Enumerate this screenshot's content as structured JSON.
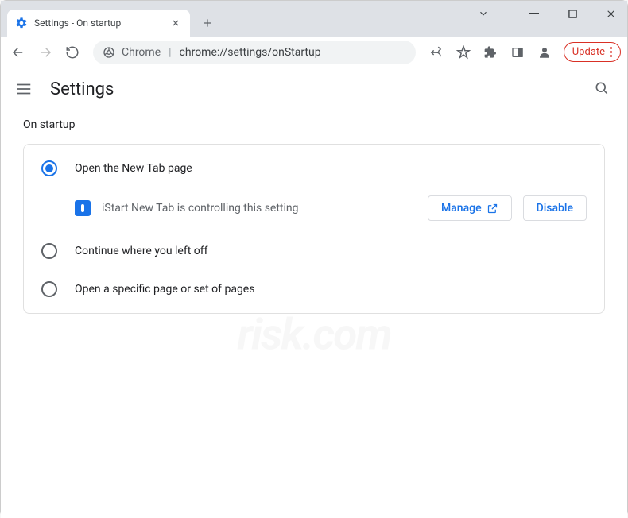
{
  "window": {
    "tab_title": "Settings - On startup"
  },
  "toolbar": {
    "omni_prefix": "Chrome",
    "omni_path": "chrome://settings/onStartup",
    "update_label": "Update"
  },
  "header": {
    "title": "Settings"
  },
  "section": {
    "title": "On startup",
    "options": [
      {
        "label": "Open the New Tab page",
        "checked": true
      },
      {
        "label": "Continue where you left off",
        "checked": false
      },
      {
        "label": "Open a specific page or set of pages",
        "checked": false
      }
    ],
    "controlled": {
      "text": "iStart New Tab is controlling this setting",
      "manage_label": "Manage",
      "disable_label": "Disable"
    }
  },
  "colors": {
    "accent": "#1a73e8",
    "danger": "#d93025"
  }
}
